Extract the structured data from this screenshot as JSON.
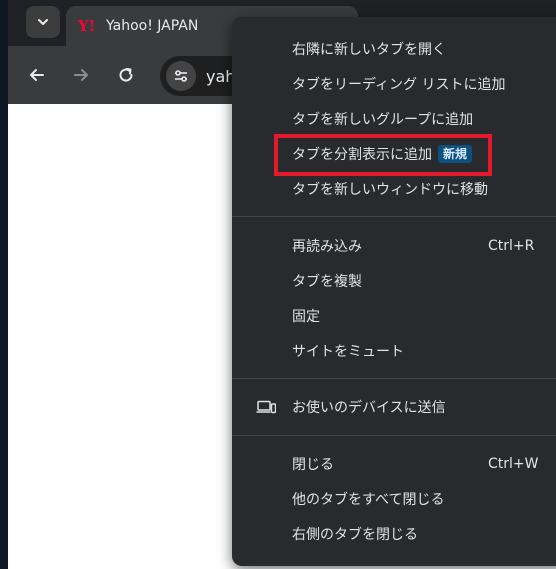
{
  "tab": {
    "title": "Yahoo! JAPAN",
    "favicon": "Y!"
  },
  "behind_tab_title": "…",
  "omnibox": {
    "url_fragment": "yah"
  },
  "menu": {
    "items": [
      {
        "label": "右隣に新しいタブを開く"
      },
      {
        "label": "タブをリーディング リストに追加"
      },
      {
        "label": "タブを新しいグループに追加"
      },
      {
        "label": "タブを分割表示に追加",
        "badge": "新規"
      },
      {
        "label": "タブを新しいウィンドウに移動"
      },
      {
        "label": "再読み込み",
        "shortcut": "Ctrl+R"
      },
      {
        "label": "タブを複製"
      },
      {
        "label": "固定"
      },
      {
        "label": "サイトをミュート"
      },
      {
        "label": "お使いのデバイスに送信",
        "icon": "devices-icon"
      },
      {
        "label": "閉じる",
        "shortcut": "Ctrl+W"
      },
      {
        "label": "他のタブをすべて閉じる"
      },
      {
        "label": "右側のタブを閉じる"
      }
    ]
  },
  "colors": {
    "highlight": "#e21a2c",
    "badge_bg": "#0e4f7d",
    "menu_bg": "#292a2d",
    "favicon": "#ff0033"
  }
}
